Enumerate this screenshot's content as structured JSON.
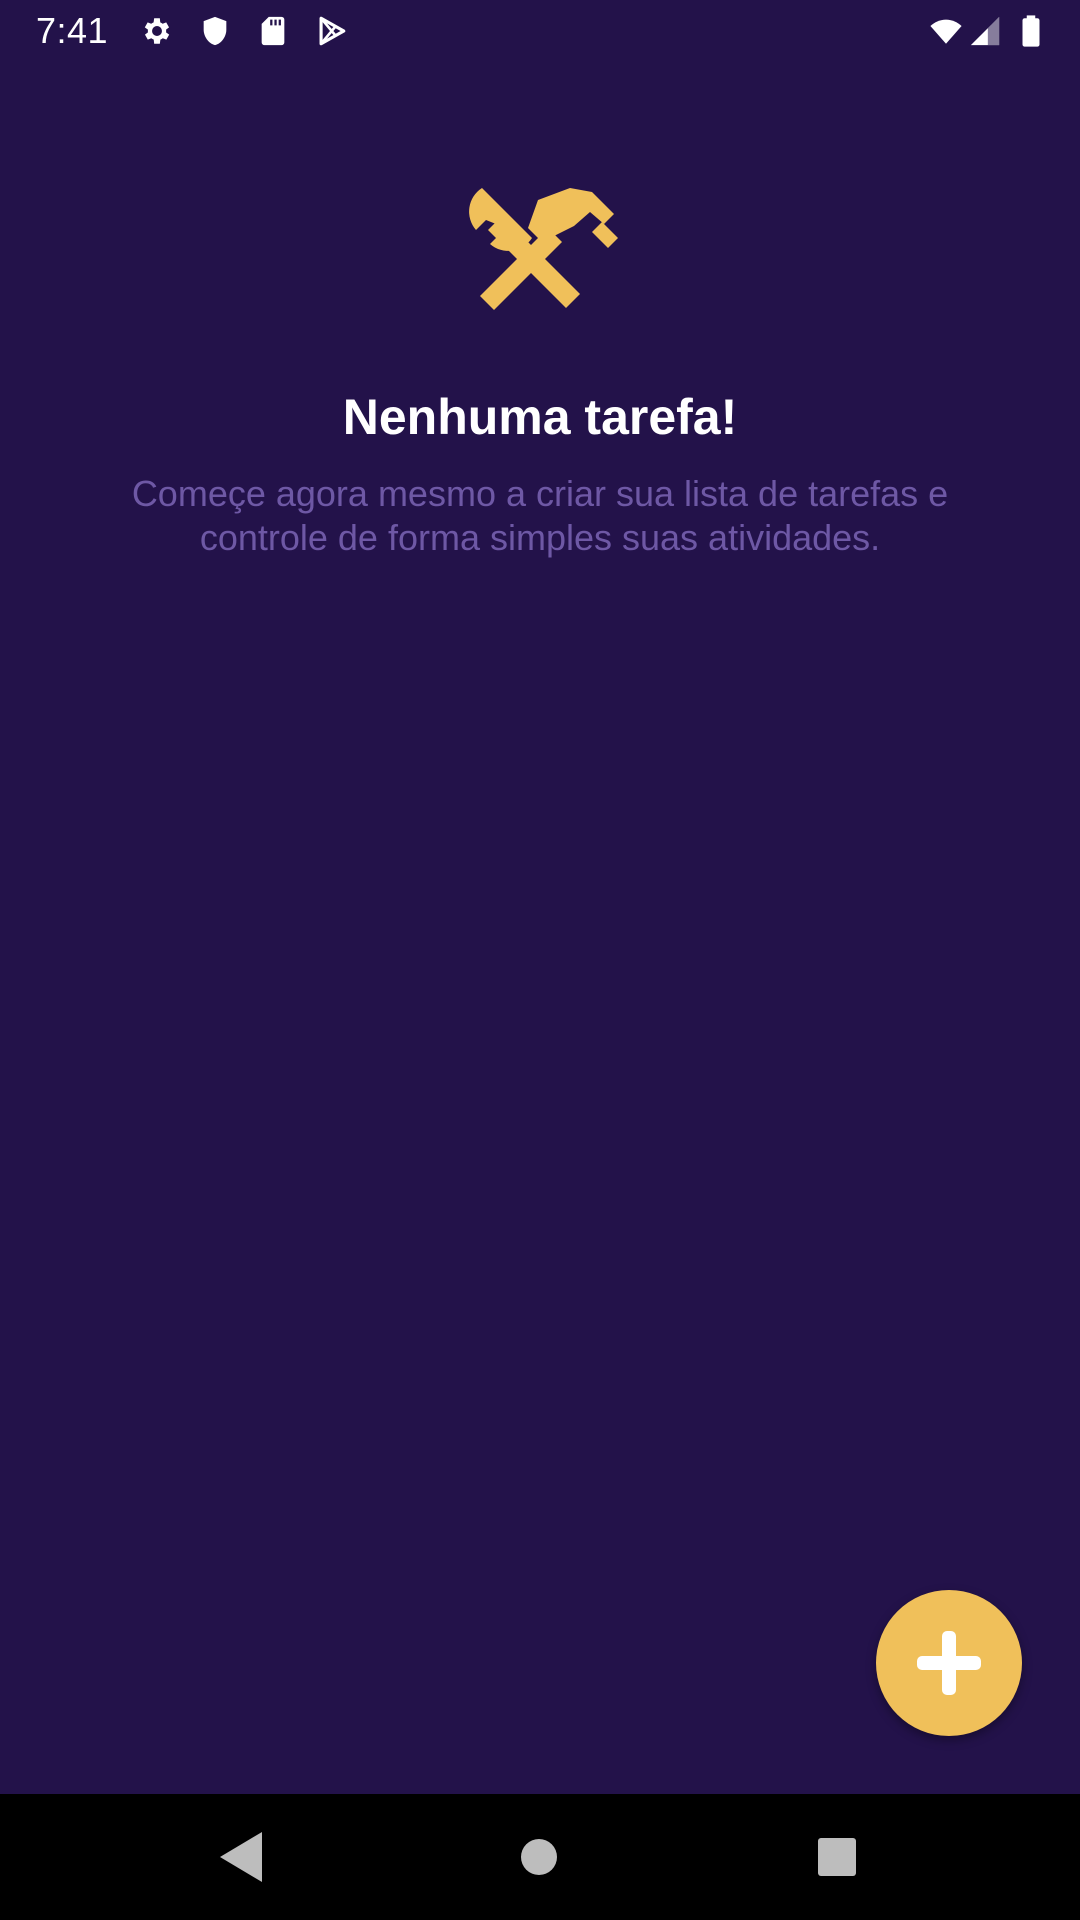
{
  "status_bar": {
    "time": "7:41",
    "icons": [
      "settings-icon",
      "shield-icon",
      "sd-card-icon",
      "play-store-icon",
      "wifi-icon",
      "cell-signal-icon",
      "battery-icon"
    ]
  },
  "empty_state": {
    "icon": "tools-icon",
    "title": "Nenhuma tarefa!",
    "subtitle": "Começe agora mesmo a criar sua lista de tarefas e controle de forma simples suas atividades."
  },
  "fab": {
    "icon": "plus-icon"
  },
  "nav_bar": {
    "buttons": [
      "back-icon",
      "home-icon",
      "recents-icon"
    ]
  },
  "colors": {
    "background": "#23124a",
    "accent": "#f0c05a",
    "title": "#ffffff",
    "subtitle": "#6e58a5",
    "nav_bar": "#000000"
  }
}
